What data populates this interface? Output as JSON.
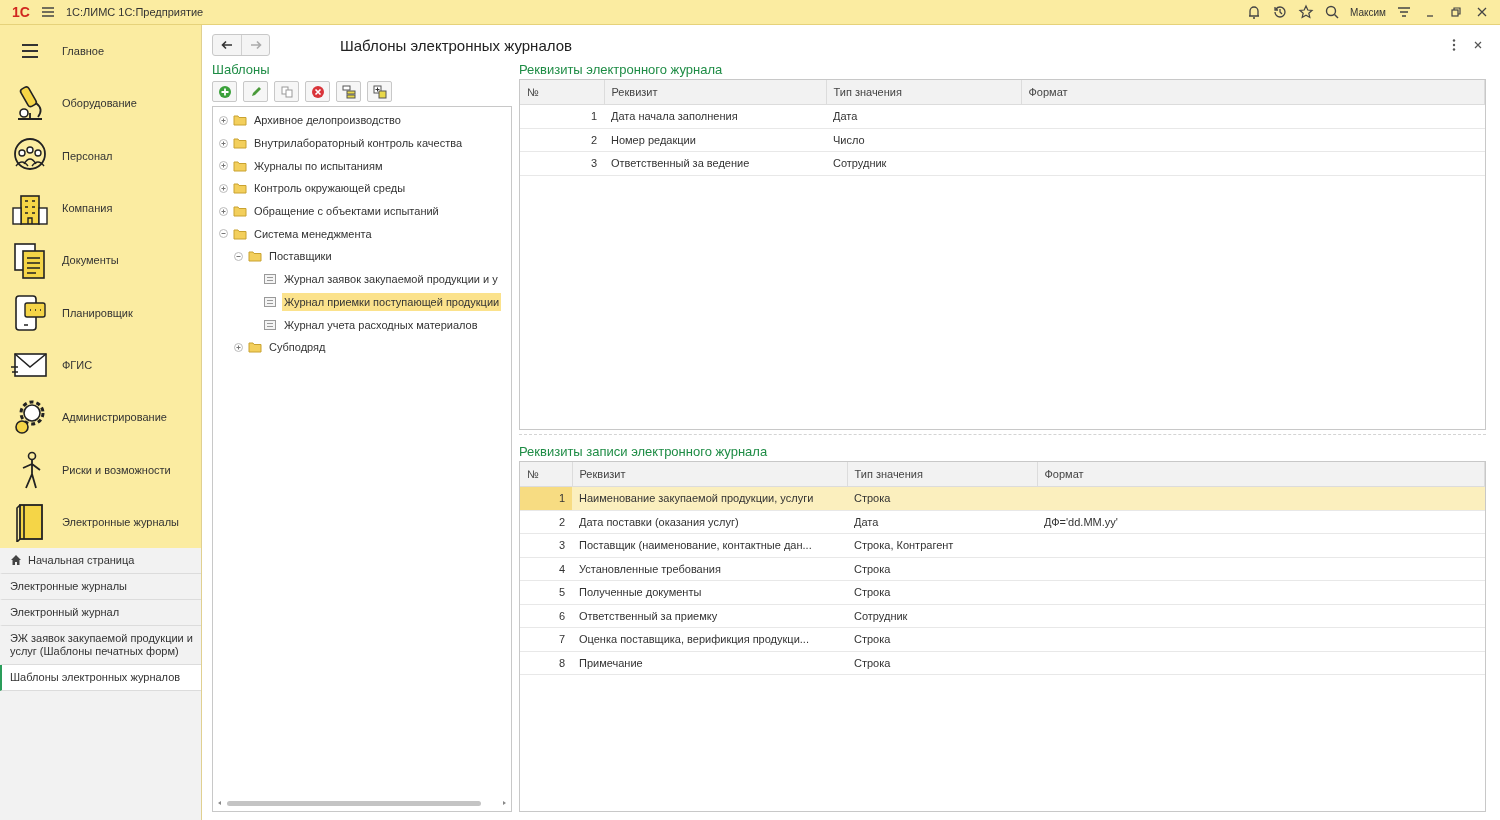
{
  "top_bar": {
    "logo": "1С",
    "app_title": "1С:ЛИМС 1С:Предприятие",
    "user": "Максим"
  },
  "sidebar": {
    "sections": [
      {
        "label": "Главное"
      },
      {
        "label": "Оборудование"
      },
      {
        "label": "Персонал"
      },
      {
        "label": "Компания"
      },
      {
        "label": "Документы"
      },
      {
        "label": "Планировщик"
      },
      {
        "label": "ФГИС"
      },
      {
        "label": "Администрирование"
      },
      {
        "label": "Риски и возможности"
      },
      {
        "label": "Электронные журналы"
      }
    ],
    "history": [
      {
        "label": "Начальная страница",
        "kind": "home",
        "selected": false
      },
      {
        "label": "Электронные журналы",
        "kind": "page",
        "selected": false
      },
      {
        "label": "Электронный журнал",
        "kind": "page",
        "selected": false
      },
      {
        "label": "ЭЖ заявок закупаемой продукции и услуг (Шаблоны печатных форм)",
        "kind": "page",
        "selected": false
      },
      {
        "label": "Шаблоны электронных журналов",
        "kind": "page",
        "selected": true
      }
    ]
  },
  "form": {
    "title": "Шаблоны электронных журналов",
    "tree": {
      "title": "Шаблоны",
      "items": [
        {
          "label": "Архивное делопроизводство",
          "kind": "folder",
          "expanded": false,
          "selected": false
        },
        {
          "label": "Внутрилабораторный контроль качества",
          "kind": "folder",
          "expanded": false,
          "selected": false
        },
        {
          "label": "Журналы по испытаниям",
          "kind": "folder",
          "expanded": false,
          "selected": false
        },
        {
          "label": "Контроль окружающей среды",
          "kind": "folder",
          "expanded": false,
          "selected": false
        },
        {
          "label": "Обращение с объектами испытаний",
          "kind": "folder",
          "expanded": false,
          "selected": false
        },
        {
          "label": "Система менеджмента",
          "kind": "folder",
          "expanded": true,
          "selected": false,
          "children": [
            {
              "label": "Поставщики",
              "kind": "folder",
              "expanded": true,
              "selected": false,
              "children": [
                {
                  "label": "Журнал заявок закупаемой продукции и у",
                  "kind": "document",
                  "selected": false
                },
                {
                  "label": "Журнал приемки поступающей продукции",
                  "kind": "document",
                  "selected": true
                },
                {
                  "label": "Журнал учета расходных материалов",
                  "kind": "document",
                  "selected": false
                }
              ]
            },
            {
              "label": "Субподряд",
              "kind": "folder",
              "expanded": false,
              "selected": false
            }
          ]
        }
      ]
    },
    "journal_attributes": {
      "title": "Реквизиты электронного журнала",
      "columns": [
        "№",
        "Реквизит",
        "Тип значения",
        "Формат"
      ],
      "rows": [
        {
          "cells": [
            "1",
            "Дата начала заполнения",
            "Дата",
            ""
          ],
          "selected": false
        },
        {
          "cells": [
            "2",
            "Номер редакции",
            "Число",
            ""
          ],
          "selected": false
        },
        {
          "cells": [
            "3",
            "Ответственный за ведение",
            "Сотрудник",
            ""
          ],
          "selected": false
        }
      ]
    },
    "record_attributes": {
      "title": "Реквизиты записи электронного журнала",
      "columns": [
        "№",
        "Реквизит",
        "Тип значения",
        "Формат"
      ],
      "rows": [
        {
          "cells": [
            "1",
            "Наименование закупаемой продукции, услуги",
            "Строка",
            ""
          ],
          "selected": true
        },
        {
          "cells": [
            "2",
            "Дата поставки (оказания услуг)",
            "Дата",
            "ДФ='dd.MM.yy'"
          ],
          "selected": false
        },
        {
          "cells": [
            "3",
            "Поставщик (наименование, контактные дан...",
            "Строка, Контрагент",
            ""
          ],
          "selected": false
        },
        {
          "cells": [
            "4",
            "Установленные требования",
            "Строка",
            ""
          ],
          "selected": false
        },
        {
          "cells": [
            "5",
            "Полученные документы",
            "Строка",
            ""
          ],
          "selected": false
        },
        {
          "cells": [
            "6",
            "Ответственный за приемку",
            "Сотрудник",
            ""
          ],
          "selected": false
        },
        {
          "cells": [
            "7",
            "Оценка поставщика, верификция продукци...",
            "Строка",
            ""
          ],
          "selected": false
        },
        {
          "cells": [
            "8",
            "Примечание",
            "Строка",
            ""
          ],
          "selected": false
        }
      ]
    }
  }
}
